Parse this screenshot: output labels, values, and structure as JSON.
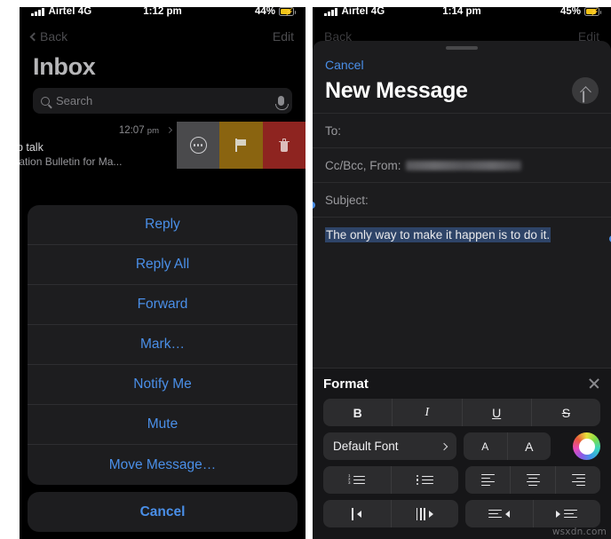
{
  "left_phone": {
    "status_bar": {
      "carrier": "Airtel 4G",
      "time": "1:12 pm",
      "battery_pct": "44%",
      "signal_icon": "signal-bars-icon",
      "battery_icon": "battery-charging-icon"
    },
    "nav": {
      "back_label": "Back",
      "edit_label": "Edit",
      "back_icon": "chevron-left-icon"
    },
    "page_title": "Inbox",
    "search": {
      "placeholder": "Search",
      "search_icon": "search-icon",
      "mic_icon": "microphone-icon"
    },
    "mail_row": {
      "time": "12:07",
      "meridiem": "pm",
      "line1": "ep talk",
      "line2": "nication Bulletin for Ma...",
      "disclosure_icon": "chevron-right-icon"
    },
    "swipe_actions": [
      {
        "name": "more",
        "icon": "more-circle-icon",
        "color": "#4a4a4c"
      },
      {
        "name": "flag",
        "icon": "flag-icon",
        "color": "#8a6410"
      },
      {
        "name": "trash",
        "icon": "trash-icon",
        "color": "#8e2420"
      }
    ],
    "action_sheet": {
      "items": [
        {
          "label": "Reply"
        },
        {
          "label": "Reply All"
        },
        {
          "label": "Forward"
        },
        {
          "label": "Mark…"
        },
        {
          "label": "Notify Me"
        },
        {
          "label": "Mute"
        },
        {
          "label": "Move Message…"
        }
      ],
      "cancel_label": "Cancel"
    }
  },
  "right_phone": {
    "status_bar": {
      "carrier": "Airtel 4G",
      "time": "1:14 pm",
      "battery_pct": "45%",
      "signal_icon": "signal-bars-icon",
      "battery_icon": "battery-charging-icon"
    },
    "background_nav": {
      "back_label": "Back",
      "edit_label": "Edit"
    },
    "compose": {
      "cancel_label": "Cancel",
      "title": "New Message",
      "send_icon": "arrow-up-icon",
      "fields": [
        {
          "label": "To:",
          "value": ""
        },
        {
          "label": "Cc/Bcc, From:",
          "value": "",
          "redacted": true
        },
        {
          "label": "Subject:",
          "value": ""
        }
      ],
      "body_text": "The only way to make it happen is to do it.",
      "selection": true
    },
    "format_panel": {
      "title": "Format",
      "close_icon": "close-icon",
      "style_buttons": [
        {
          "label": "B",
          "name": "bold"
        },
        {
          "label": "I",
          "name": "italic"
        },
        {
          "label": "U",
          "name": "underline"
        },
        {
          "label": "S",
          "name": "strikethrough"
        }
      ],
      "font_name": "Default Font",
      "font_chevron_icon": "chevron-right-icon",
      "size_buttons": [
        {
          "label": "A",
          "name": "decrease-font-size"
        },
        {
          "label": "A",
          "name": "increase-font-size"
        }
      ],
      "color_wheel_icon": "color-wheel-icon",
      "list_buttons": [
        {
          "name": "numbered-list",
          "icon": "numbered-list-icon"
        },
        {
          "name": "bulleted-list",
          "icon": "bulleted-list-icon"
        }
      ],
      "align_buttons": [
        {
          "name": "align-left",
          "icon": "align-left-icon"
        },
        {
          "name": "align-center",
          "icon": "align-center-icon"
        },
        {
          "name": "align-right",
          "icon": "align-right-icon"
        }
      ],
      "indent_buttons": [
        {
          "name": "outdent",
          "icon": "outdent-icon"
        },
        {
          "name": "indent",
          "icon": "indent-icon"
        }
      ],
      "quote_buttons": [
        {
          "name": "decrease-quote-level",
          "icon": "quote-decrease-icon"
        },
        {
          "name": "increase-quote-level",
          "icon": "quote-increase-icon"
        }
      ]
    }
  },
  "watermark": "wsxdn.com"
}
